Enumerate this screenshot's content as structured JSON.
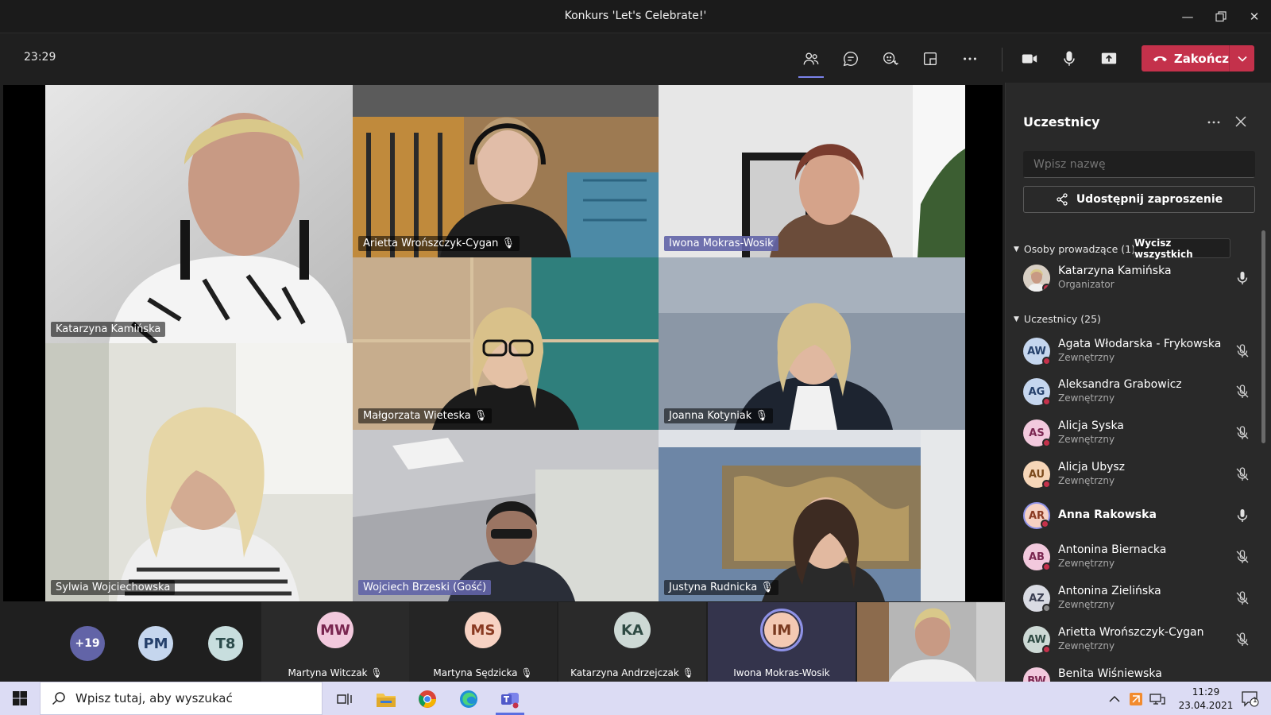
{
  "window": {
    "title": "Konkurs 'Let's Celebrate!'"
  },
  "toolbar": {
    "clock": "23:29",
    "end_label": "Zakończ"
  },
  "stage": {
    "tiles": [
      {
        "name": "Katarzyna Kamińska",
        "speaking": false
      },
      {
        "name": "Arietta Wrońszczyk-Cygan",
        "speaking": false
      },
      {
        "name": "Iwona Mokras-Wosik",
        "speaking": true
      },
      {
        "name": "Małgorzata Wieteska",
        "speaking": false
      },
      {
        "name": "Joanna Kotyniak",
        "speaking": false
      },
      {
        "name": "Sylwia  Wojciechowska",
        "speaking": false
      },
      {
        "name": "Wojciech Brzeski (Gość)",
        "speaking": false
      },
      {
        "name": "Justyna Rudnicka",
        "speaking": false
      }
    ]
  },
  "strip": {
    "overflow": "+19",
    "small": [
      "PM",
      "T8"
    ],
    "people": [
      {
        "initials": "MW",
        "name": "Martyna Witczak"
      },
      {
        "initials": "MS",
        "name": "Martyna Sędzicka"
      },
      {
        "initials": "KA",
        "name": "Katarzyna Andrzejczak"
      },
      {
        "initials": "IM",
        "name": "Iwona Mokras-Wosik"
      }
    ]
  },
  "panel": {
    "title": "Uczestnicy",
    "search_placeholder": "Wpisz nazwę",
    "share_label": "Udostępnij zaproszenie",
    "presenters_label": "Osoby prowadzące (1)",
    "clear_all": "Wycisz wszystkich",
    "attendees_label": "Uczestnicy (25)",
    "organizer": {
      "initials": "",
      "name": "Katarzyna Kamińska",
      "role": "Organizator"
    },
    "attendees": [
      {
        "initials": "AW",
        "name": "Agata Włodarska - Frykowska",
        "role": "Zewnętrzny",
        "muted": true
      },
      {
        "initials": "AG",
        "name": "Aleksandra Grabowicz",
        "role": "Zewnętrzny",
        "muted": true
      },
      {
        "initials": "AS",
        "name": "Alicja Syska",
        "role": "Zewnętrzny",
        "muted": true
      },
      {
        "initials": "AU",
        "name": "Alicja Ubysz",
        "role": "Zewnętrzny",
        "muted": true
      },
      {
        "initials": "AR",
        "name": "Anna Rakowska",
        "role": "",
        "muted": false
      },
      {
        "initials": "AB",
        "name": "Antonina Biernacka",
        "role": "Zewnętrzny",
        "muted": true
      },
      {
        "initials": "AZ",
        "name": "Antonina Zielińska",
        "role": "Zewnętrzny",
        "muted": true
      },
      {
        "initials": "AW",
        "name": "Arietta Wrońszczyk-Cygan",
        "role": "Zewnętrzny",
        "muted": true
      },
      {
        "initials": "BW",
        "name": "Benita Wiśniewska",
        "role": "",
        "muted": true
      }
    ]
  },
  "taskbar": {
    "search_placeholder": "Wpisz tutaj, aby wyszukać",
    "time": "11:29",
    "date": "23.04.2021",
    "notifications": "1"
  },
  "colors": {
    "accent": "#6264a7",
    "end": "#c4314b",
    "taskbar": "#dcdcf4"
  }
}
